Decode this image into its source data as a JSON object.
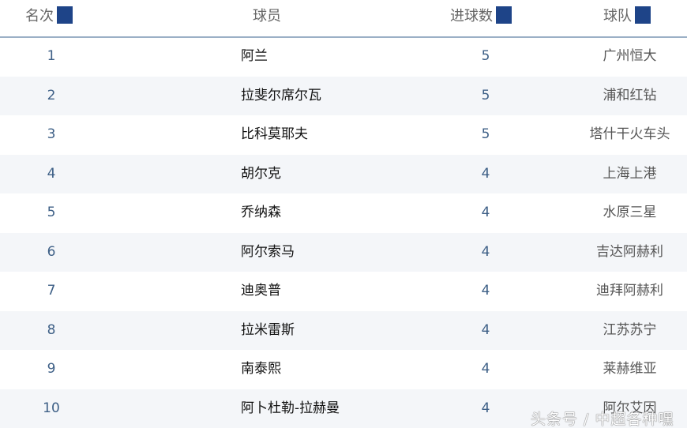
{
  "headers": {
    "rank": "名次",
    "player": "球员",
    "goals": "进球数",
    "team": "球队"
  },
  "accent": "#1e4488",
  "rows": [
    {
      "rank": "1",
      "player": "阿兰",
      "goals": "5",
      "team": "广州恒大"
    },
    {
      "rank": "2",
      "player": "拉斐尔席尔瓦",
      "goals": "5",
      "team": "浦和红钻"
    },
    {
      "rank": "3",
      "player": "比科莫耶夫",
      "goals": "5",
      "team": "塔什干火车头"
    },
    {
      "rank": "4",
      "player": "胡尔克",
      "goals": "4",
      "team": "上海上港"
    },
    {
      "rank": "5",
      "player": "乔纳森",
      "goals": "4",
      "team": "水原三星"
    },
    {
      "rank": "6",
      "player": "阿尔索马",
      "goals": "4",
      "team": "吉达阿赫利"
    },
    {
      "rank": "7",
      "player": "迪奥普",
      "goals": "4",
      "team": "迪拜阿赫利"
    },
    {
      "rank": "8",
      "player": "拉米雷斯",
      "goals": "4",
      "team": "江苏苏宁"
    },
    {
      "rank": "9",
      "player": "南泰熙",
      "goals": "4",
      "team": "莱赫维亚"
    },
    {
      "rank": "10",
      "player": "阿卜杜勒-拉赫曼",
      "goals": "4",
      "team": "阿尔艾因"
    }
  ],
  "watermark": "头条号 / 中超各种嘿"
}
